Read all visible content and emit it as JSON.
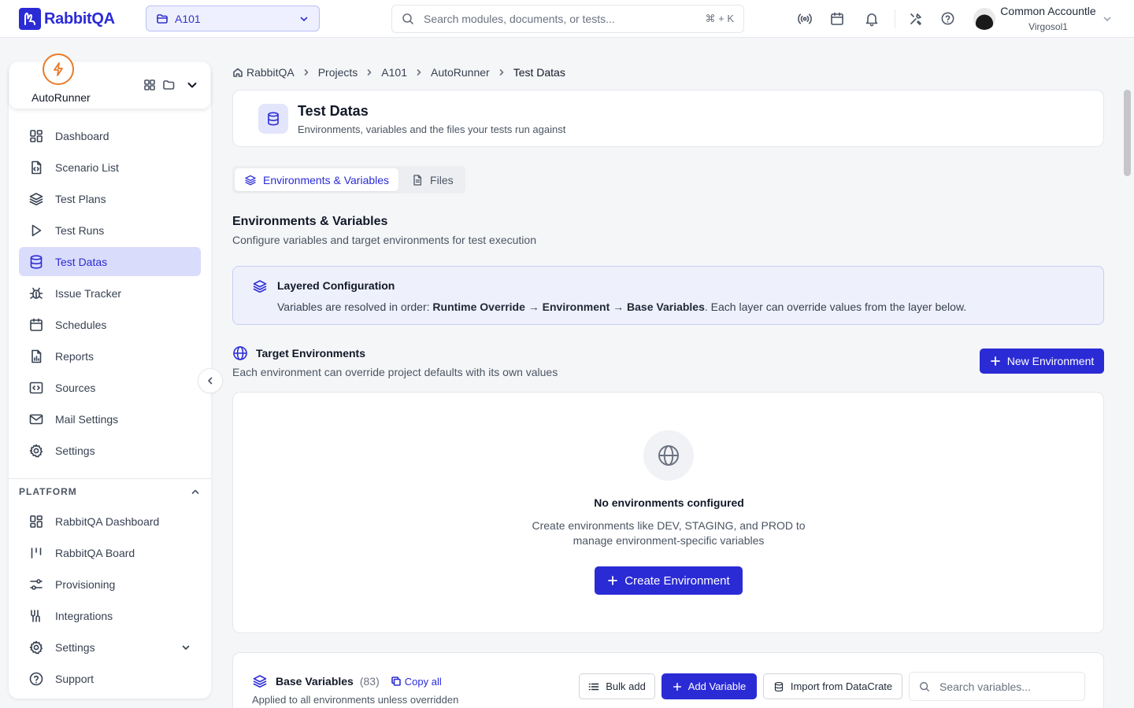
{
  "brand": {
    "name": "RabbitQA",
    "color": "#2b2bd6"
  },
  "project_selector": {
    "value": "A101"
  },
  "search": {
    "placeholder": "Search modules, documents, or tests...",
    "shortcut": "⌘ + K"
  },
  "user": {
    "name": "Common Accountle",
    "org": "Virgosol1"
  },
  "app": {
    "name": "AutoRunner"
  },
  "nav_items": [
    {
      "label": "Dashboard",
      "icon": "grid-icon"
    },
    {
      "label": "Scenario List",
      "icon": "file-code-icon"
    },
    {
      "label": "Test Plans",
      "icon": "layers-icon"
    },
    {
      "label": "Test Runs",
      "icon": "play-icon"
    },
    {
      "label": "Test Datas",
      "icon": "database-icon",
      "active": true
    },
    {
      "label": "Issue Tracker",
      "icon": "bug-icon"
    },
    {
      "label": "Schedules",
      "icon": "calendar-icon"
    },
    {
      "label": "Reports",
      "icon": "report-icon"
    },
    {
      "label": "Sources",
      "icon": "code-icon"
    },
    {
      "label": "Mail Settings",
      "icon": "mail-icon"
    },
    {
      "label": "Settings",
      "icon": "gear-icon"
    }
  ],
  "platform": {
    "title": "PLATFORM",
    "items": [
      {
        "label": "RabbitQA Dashboard",
        "icon": "grid-icon"
      },
      {
        "label": "RabbitQA Board",
        "icon": "board-icon"
      },
      {
        "label": "Provisioning",
        "icon": "sliders-icon"
      },
      {
        "label": "Integrations",
        "icon": "integration-icon"
      },
      {
        "label": "Settings",
        "icon": "gear-icon"
      },
      {
        "label": "Support",
        "icon": "help-icon"
      }
    ]
  },
  "breadcrumb": [
    "RabbitQA",
    "Projects",
    "A101",
    "AutoRunner",
    "Test Datas"
  ],
  "page": {
    "title": "Test Datas",
    "subtitle": "Environments, variables and the files your tests run against"
  },
  "tabs": [
    {
      "label": "Environments & Variables",
      "active": true
    },
    {
      "label": "Files",
      "active": false
    }
  ],
  "section": {
    "title": "Environments & Variables",
    "subtitle": "Configure variables and target environments for test execution"
  },
  "info": {
    "title": "Layered Configuration",
    "prefix": "Variables are resolved in order: ",
    "layer1": "Runtime Override",
    "arrow": " → ",
    "layer2": "Environment",
    "layer3": "Base Variables",
    "suffix": ". Each layer can override values from the layer below."
  },
  "environments": {
    "title": "Target Environments",
    "subtitle": "Each environment can override project defaults with its own values",
    "new_button": "New Environment",
    "empty_title": "No environments configured",
    "empty_desc": "Create environments like DEV, STAGING, and PROD to manage environment-specific variables",
    "create_button": "Create Environment"
  },
  "base_variables": {
    "title": "Base Variables",
    "count": "(83)",
    "copy_all": "Copy all",
    "subtitle": "Applied to all environments unless overridden",
    "bulk_add": "Bulk add",
    "add_variable": "Add Variable",
    "import": "Import from DataCrate",
    "search_placeholder": "Search variables..."
  }
}
